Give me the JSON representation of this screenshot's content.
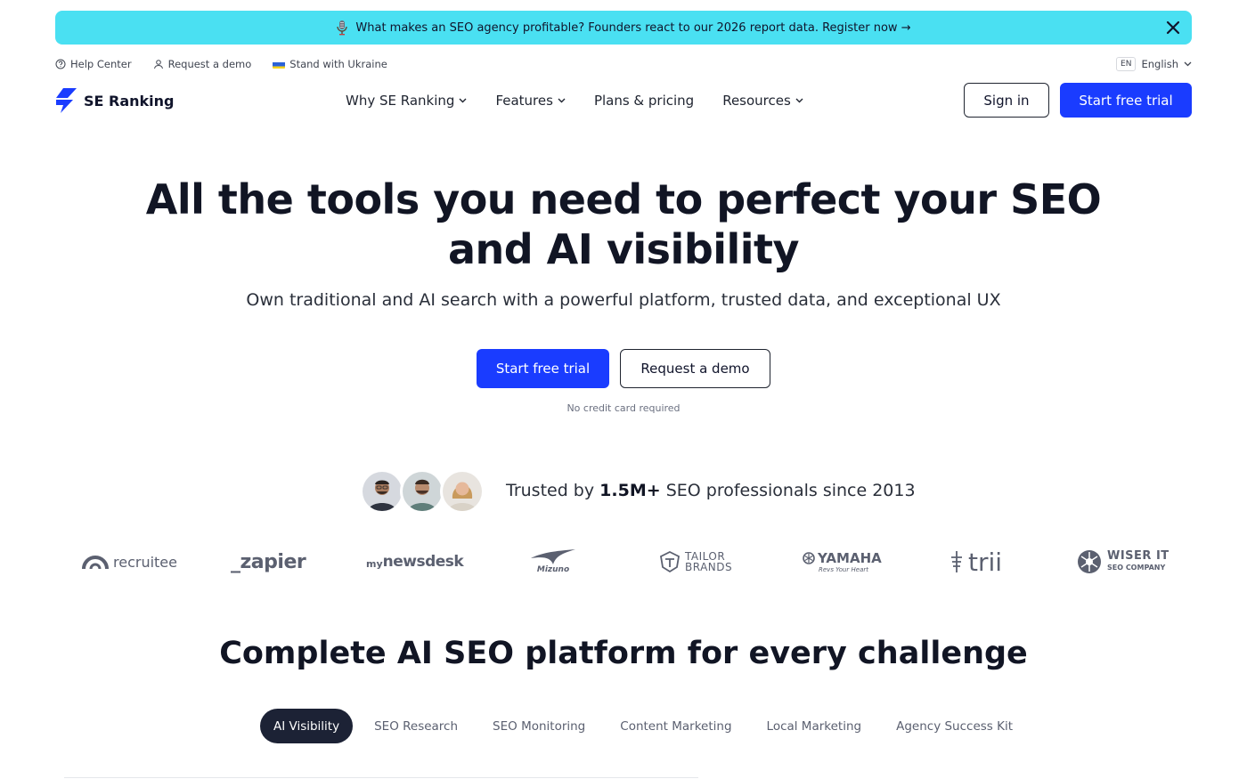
{
  "banner": {
    "text": "What makes an SEO agency profitable? Founders react to our 2026 report data. Register now →",
    "icon": "microphone-icon",
    "close_icon": "close-icon"
  },
  "utility": {
    "help": "Help Center",
    "demo": "Request a demo",
    "ukraine": "Stand with Ukraine",
    "lang_code": "EN",
    "lang": "English"
  },
  "nav": {
    "brand": "SE Ranking",
    "links": [
      "Why SE Ranking",
      "Features",
      "Plans & pricing",
      "Resources"
    ],
    "signin": "Sign in",
    "trial": "Start free trial"
  },
  "hero": {
    "title_line1": "All the tools you need to perfect your SEO",
    "title_line2": "and AI visibility",
    "subtitle": "Own traditional and AI search with a powerful platform, trusted data, and exceptional UX",
    "cta_primary": "Start free trial",
    "cta_secondary": "Request a demo",
    "note": "No credit card required"
  },
  "trusted": {
    "prefix": "Trusted by ",
    "count": "1.5M+",
    "suffix": " SEO professionals since 2013"
  },
  "logos": {
    "recruitee": "recruitee",
    "zapier": "_zapier",
    "mynewsdesk_my": "my",
    "mynewsdesk": "newsdesk",
    "mizuno": "Mizuno",
    "tailor_1": "TAILOR",
    "tailor_2": "BRANDS",
    "yamaha": "YAMAHA",
    "yamaha_tag": "Revs Your Heart",
    "trii": "trii",
    "wiser_1": "WISER IT",
    "wiser_2": "SEO COMPANY"
  },
  "section": {
    "title": "Complete AI SEO platform for every challenge",
    "tabs": [
      "AI Visibility",
      "SEO Research",
      "SEO Monitoring",
      "Content Marketing",
      "Local Marketing",
      "Agency Success Kit"
    ]
  },
  "colors": {
    "accent": "#1a3cff",
    "banner": "#4ae0f2",
    "dark": "#1c2235"
  }
}
